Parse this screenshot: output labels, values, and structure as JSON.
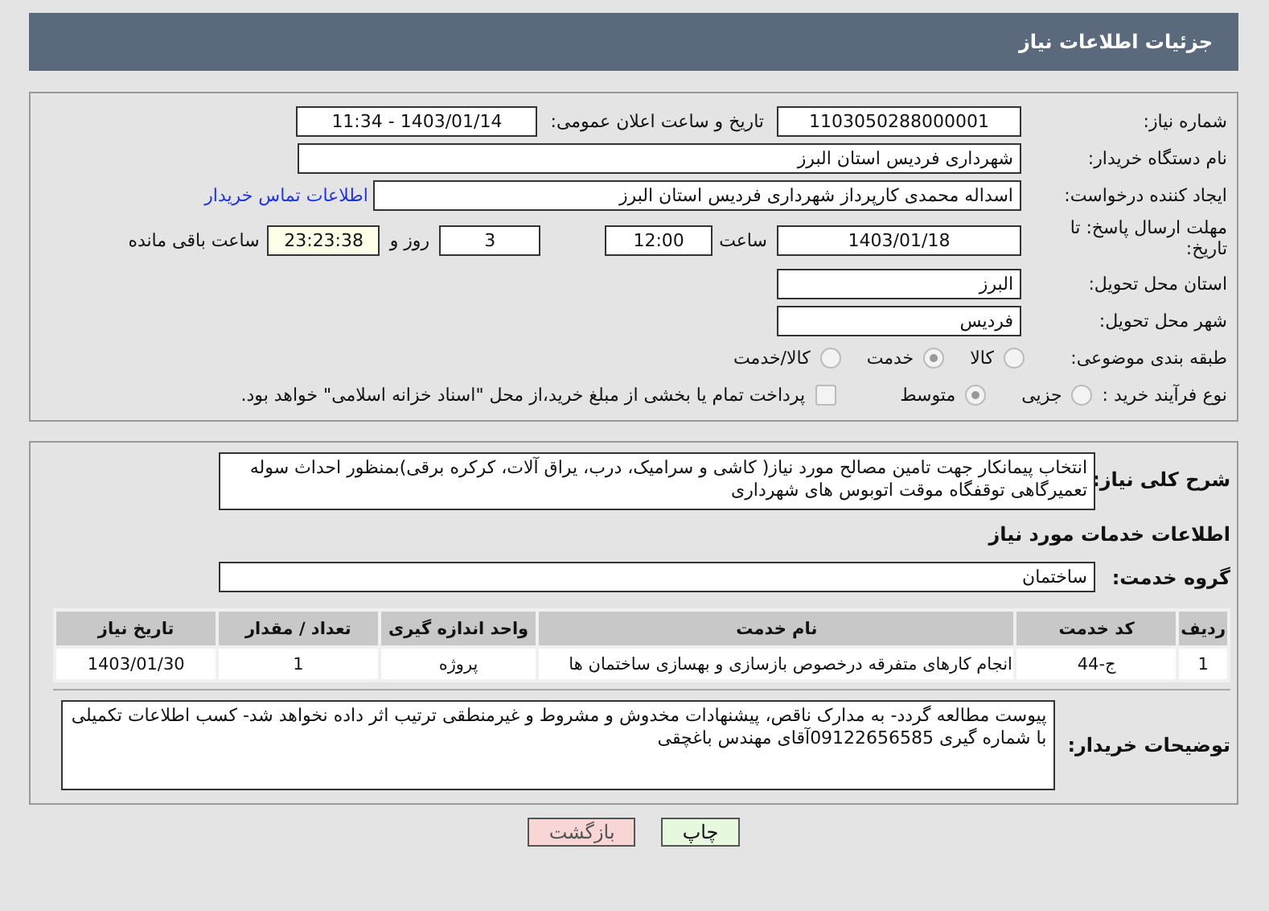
{
  "header": {
    "title": "جزئیات اطلاعات نیاز"
  },
  "details": {
    "need_number": {
      "label": "شماره نیاز:",
      "value": "1103050288000001"
    },
    "announce": {
      "label": "تاریخ و ساعت اعلان عمومی:",
      "value": "1403/01/14 - 11:34"
    },
    "buyer": {
      "label": "نام دستگاه خریدار:",
      "value": "شهرداری فردیس استان البرز"
    },
    "creator": {
      "label": "ایجاد کننده درخواست:",
      "value": "اسداله محمدی کارپرداز شهرداری فردیس استان البرز",
      "link": "اطلاعات تماس خریدار"
    },
    "deadline": {
      "label": "مهلت ارسال پاسخ: تا تاریخ:",
      "date": "1403/01/18",
      "time_label": "ساعت",
      "time": "12:00",
      "days": "3",
      "days_label": "روز و",
      "remaining": "23:23:38",
      "remaining_label": "ساعت باقی مانده"
    },
    "province": {
      "label": "استان محل تحویل:",
      "value": "البرز"
    },
    "city": {
      "label": "شهر محل تحویل:",
      "value": "فردیس"
    },
    "category": {
      "label": "طبقه بندی موضوعی:",
      "options": [
        {
          "label": "کالا",
          "selected": false
        },
        {
          "label": "خدمت",
          "selected": true
        },
        {
          "label": "کالا/خدمت",
          "selected": false
        }
      ]
    },
    "process": {
      "label": "نوع فرآیند خرید :",
      "options": [
        {
          "label": "جزیی",
          "selected": false
        },
        {
          "label": "متوسط",
          "selected": true
        }
      ],
      "payment": {
        "label": "پرداخت تمام یا بخشی از مبلغ خرید،از محل \"اسناد خزانه اسلامی\" خواهد بود.",
        "checked": false
      }
    }
  },
  "services": {
    "description": {
      "label": "شرح کلی نیاز:",
      "value": "انتخاب پیمانکار جهت تامین مصالح مورد نیاز( کاشی و سرامیک، درب، یراق آلات، کرکره برقی)بمنظور احداث سوله تعمیرگاهی توقفگاه موقت اتوبوس های شهرداری"
    },
    "section_title": "اطلاعات خدمات مورد نیاز",
    "group": {
      "label": "گروه خدمت:",
      "value": "ساختمان"
    },
    "table": {
      "columns": [
        "ردیف",
        "کد خدمت",
        "نام خدمت",
        "واحد اندازه گیری",
        "تعداد / مقدار",
        "تاریخ نیاز"
      ],
      "rows": [
        [
          "1",
          "ج-44",
          "انجام کارهای متفرقه درخصوص بازسازی و بهسازی ساختمان ها",
          "پروژه",
          "1",
          "1403/01/30"
        ]
      ]
    },
    "notes": {
      "label": "توضیحات خریدار:",
      "value": "پیوست مطالعه گردد- به مدارک ناقص، پیشنهادات مخدوش و مشروط و غیرمنطقی ترتیب اثر داده نخواهد شد- کسب اطلاعات تکمیلی با شماره گیری 09122656585آقای مهندس باغچقی"
    }
  },
  "buttons": [
    {
      "kind": "print",
      "label": "چاپ"
    },
    {
      "kind": "back",
      "label": "بازگشت"
    }
  ]
}
